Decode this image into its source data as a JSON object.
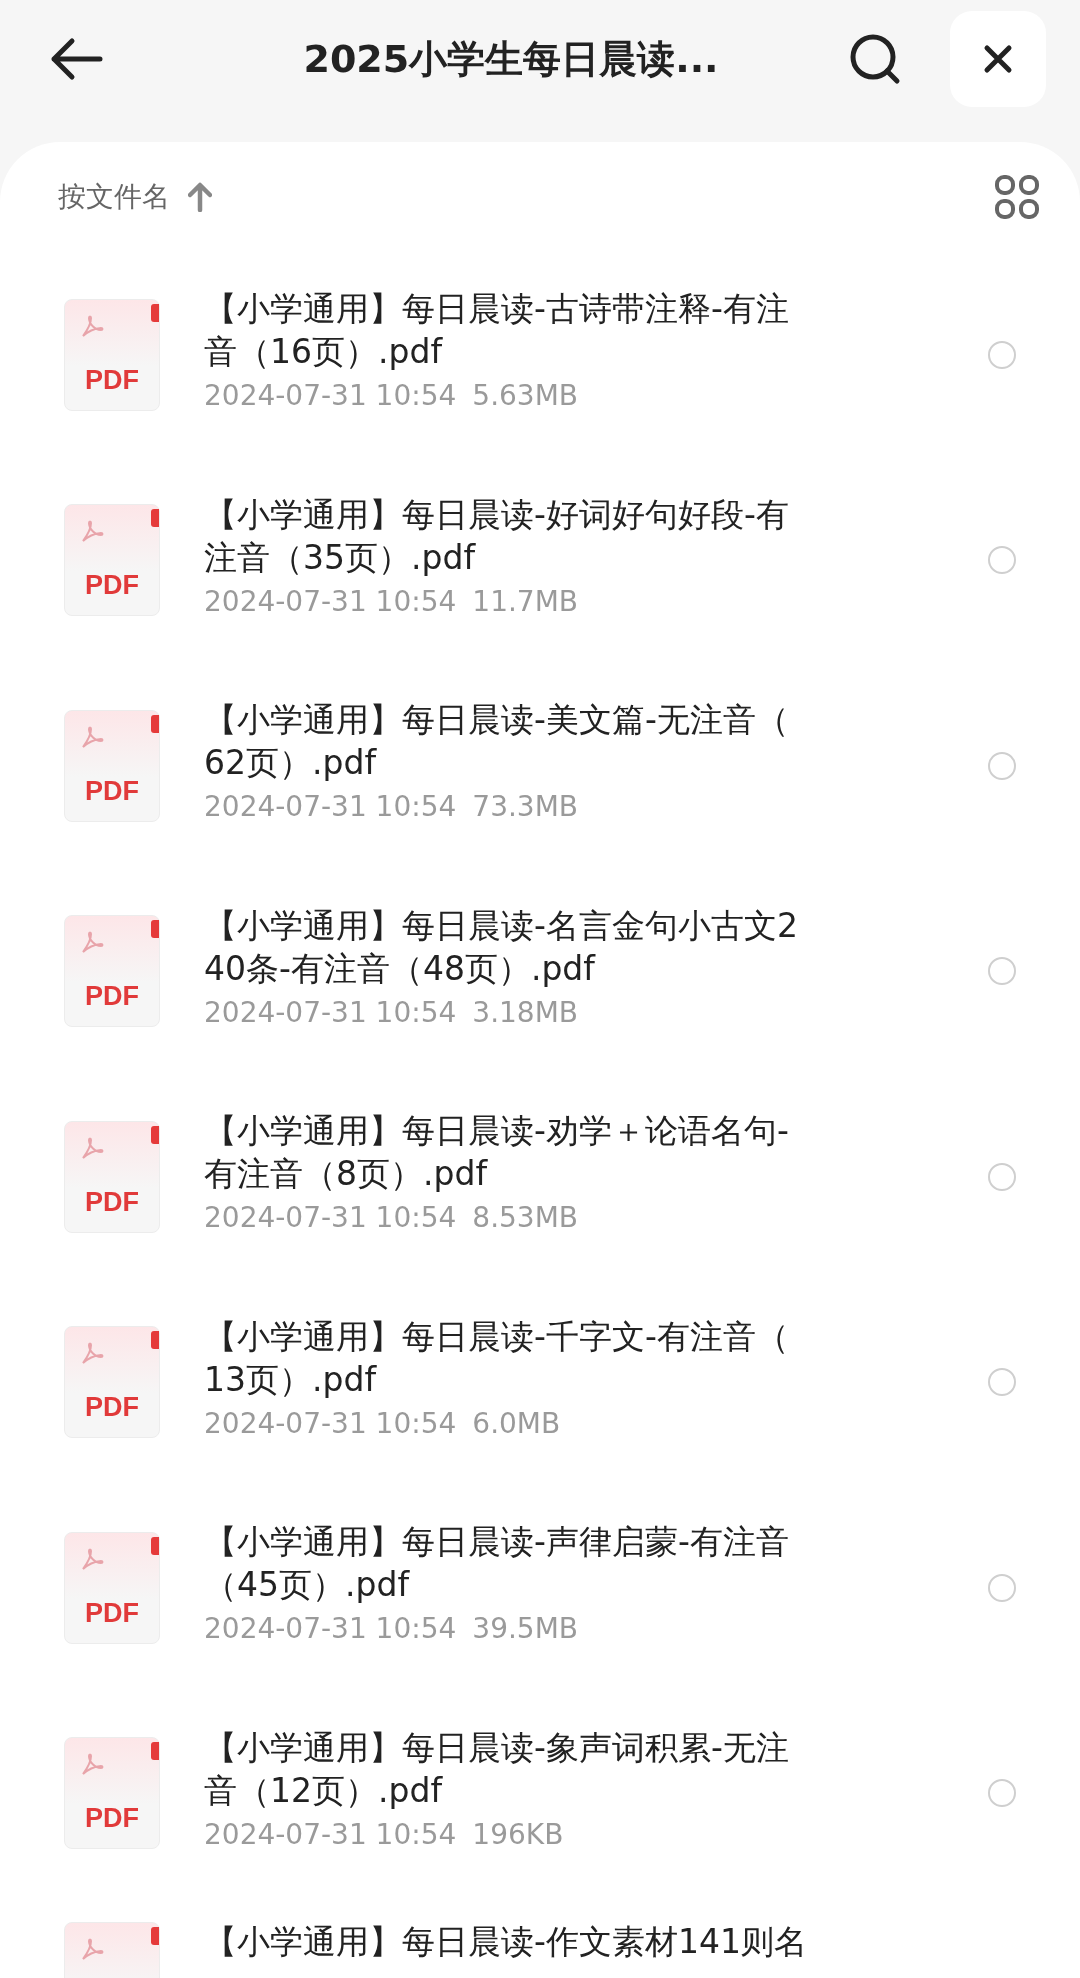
{
  "header": {
    "title": "2025小学生每日晨读..."
  },
  "sort": {
    "label": "按文件名"
  },
  "files": [
    {
      "name_lines": [
        "【小学通用】每日晨读-古诗带注释-有注",
        "音（16页）.pdf"
      ],
      "badge": "PDF",
      "date": "2024-07-31 10:54",
      "size": "5.63MB",
      "selected": false
    },
    {
      "name_lines": [
        "【小学通用】每日晨读-好词好句好段-有",
        "注音（35页）.pdf"
      ],
      "badge": "PDF",
      "date": "2024-07-31 10:54",
      "size": "11.7MB",
      "selected": false
    },
    {
      "name_lines": [
        "【小学通用】每日晨读-美文篇-无注音（",
        "62页）.pdf"
      ],
      "badge": "PDF",
      "date": "2024-07-31 10:54",
      "size": "73.3MB",
      "selected": false
    },
    {
      "name_lines": [
        "【小学通用】每日晨读-名言金句小古文2",
        "40条-有注音（48页）.pdf"
      ],
      "badge": "PDF",
      "date": "2024-07-31 10:54",
      "size": "3.18MB",
      "selected": false
    },
    {
      "name_lines": [
        "【小学通用】每日晨读-劝学＋论语名句-",
        "有注音（8页）.pdf"
      ],
      "badge": "PDF",
      "date": "2024-07-31 10:54",
      "size": "8.53MB",
      "selected": false
    },
    {
      "name_lines": [
        "【小学通用】每日晨读-千字文-有注音（",
        "13页）.pdf"
      ],
      "badge": "PDF",
      "date": "2024-07-31 10:54",
      "size": "6.0MB",
      "selected": false
    },
    {
      "name_lines": [
        "【小学通用】每日晨读-声律启蒙-有注音",
        "（45页）.pdf"
      ],
      "badge": "PDF",
      "date": "2024-07-31 10:54",
      "size": "39.5MB",
      "selected": false
    },
    {
      "name_lines": [
        "【小学通用】每日晨读-象声词积累-无注",
        "音（12页）.pdf"
      ],
      "badge": "PDF",
      "date": "2024-07-31 10:54",
      "size": "196KB",
      "selected": false
    },
    {
      "name_lines": [
        "【小学通用】每日晨读-作文素材141则名"
      ]
    }
  ]
}
